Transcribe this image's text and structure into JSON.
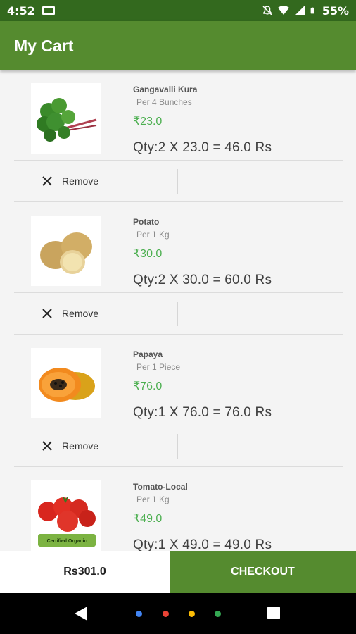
{
  "status_bar": {
    "time": "4:52",
    "battery": "55%"
  },
  "app_bar": {
    "title": "My Cart"
  },
  "cart": {
    "remove_label": "Remove",
    "items": [
      {
        "name": "Gangavalli Kura",
        "unit": "Per 4 Bunches",
        "price": "₹23.0",
        "qty_line": "Qty:2 X  23.0  = 46.0 Rs",
        "image": "greens-image"
      },
      {
        "name": "Potato",
        "unit": "Per 1 Kg",
        "price": "₹30.0",
        "qty_line": "Qty:2 X  30.0  = 60.0 Rs",
        "image": "potato-image"
      },
      {
        "name": "Papaya",
        "unit": "Per 1 Piece",
        "price": "₹76.0",
        "qty_line": "Qty:1 X  76.0  = 76.0 Rs",
        "image": "papaya-image"
      },
      {
        "name": "Tomato-Local",
        "unit": "Per 1 Kg",
        "price": "₹49.0",
        "qty_line": "Qty:1 X  49.0  = 49.0 Rs",
        "image": "tomato-image",
        "image_label": "Certified Organic"
      }
    ]
  },
  "bottom_bar": {
    "total": "Rs301.0",
    "checkout_label": "CHECKOUT"
  },
  "colors": {
    "primary": "#558b2f",
    "primary_dark": "#33691e",
    "price": "#4caf50"
  }
}
